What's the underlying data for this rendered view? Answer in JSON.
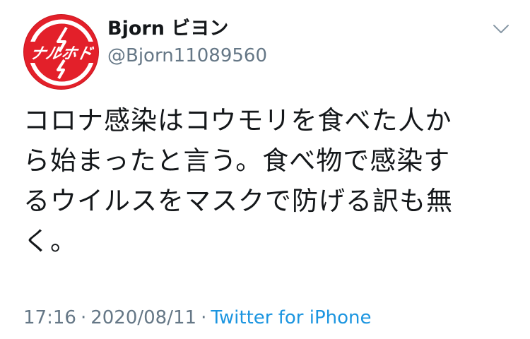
{
  "user": {
    "display_name": "Bjorn ビヨン",
    "username": "@Bjorn11089560",
    "avatar_text": "ナルホド"
  },
  "tweet": {
    "lines": [
      "コロナ感染はコウモリを食べた人か",
      "ら始まったと言う。食べ物で感染す",
      "るウイルスをマスクで防げる訳も無",
      "く。"
    ],
    "time": "17:16",
    "separator": "·",
    "date": "2020/08/11",
    "source": "Twitter for iPhone"
  },
  "icons": {
    "menu": "chevron-down-icon"
  },
  "colors": {
    "avatar_bg": "#e3202a",
    "muted": "#657786",
    "link": "#1b95e0",
    "text": "#14171a"
  }
}
